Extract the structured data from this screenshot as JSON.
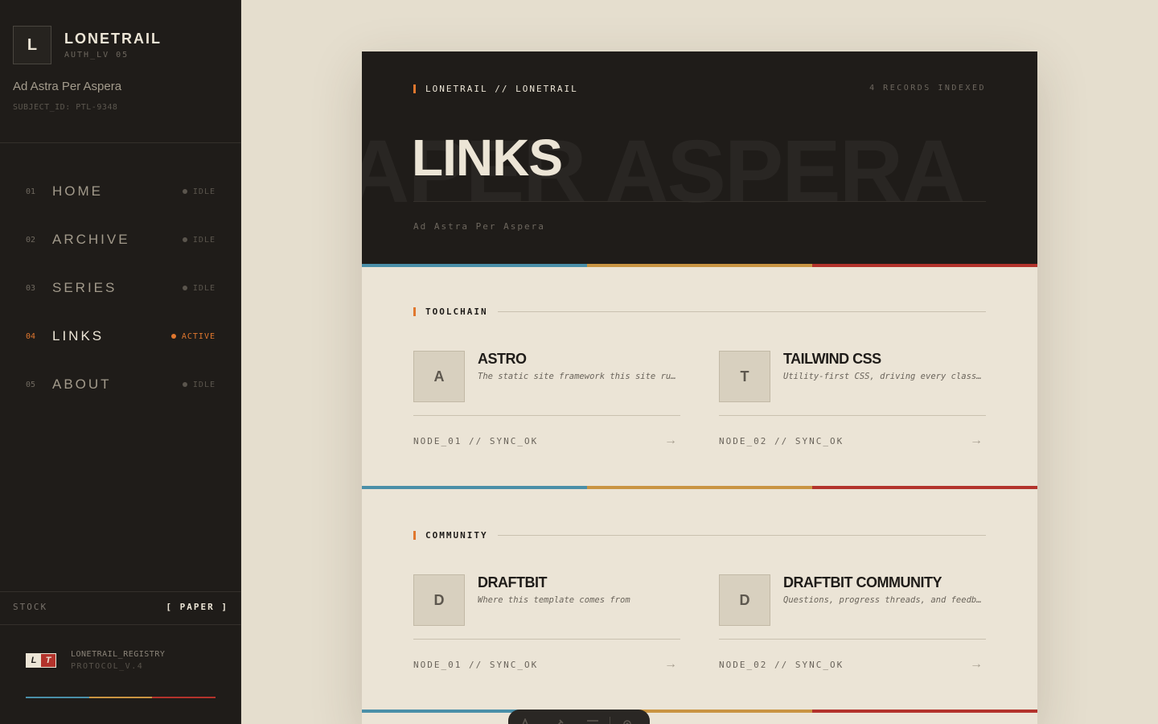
{
  "sidebar": {
    "brand_initial": "L",
    "brand_name": "LONETRAIL",
    "brand_sub": "AUTH_LV 05",
    "tagline": "Ad Astra Per Aspera",
    "subject_id": "SUBJECT_ID: PTL-9348",
    "nav": [
      {
        "num": "01",
        "label": "HOME",
        "status": "IDLE"
      },
      {
        "num": "02",
        "label": "ARCHIVE",
        "status": "IDLE"
      },
      {
        "num": "03",
        "label": "SERIES",
        "status": "IDLE"
      },
      {
        "num": "04",
        "label": "LINKS",
        "status": "ACTIVE"
      },
      {
        "num": "05",
        "label": "ABOUT",
        "status": "IDLE"
      }
    ],
    "stock_label": "STOCK",
    "stock_value": "[ PAPER ]",
    "registry_logo_l": "L",
    "registry_logo_t": "T",
    "registry_name": "LONETRAIL_REGISTRY",
    "registry_protocol": "PROTOCOL_V.4"
  },
  "hero": {
    "crumb": "LONETRAIL // LONETRAIL",
    "count": "4 RECORDS INDEXED",
    "bg_text": "APER ASPERA",
    "title": "LINKS",
    "subtitle": "Ad Astra Per Aspera"
  },
  "sections": [
    {
      "title": "TOOLCHAIN",
      "links": [
        {
          "initial": "A",
          "title": "ASTRO",
          "desc": "The static site framework this site runs on",
          "node": "NODE_01 // SYNC_OK",
          "arrow": "→"
        },
        {
          "initial": "T",
          "title": "TAILWIND CSS",
          "desc": "Utility-first CSS, driving every class on the page",
          "node": "NODE_02 // SYNC_OK",
          "arrow": "→"
        }
      ]
    },
    {
      "title": "COMMUNITY",
      "links": [
        {
          "initial": "D",
          "title": "DRAFTBIT",
          "desc": "Where this template comes from",
          "node": "NODE_01 // SYNC_OK",
          "arrow": "→"
        },
        {
          "initial": "D",
          "title": "DRAFTBIT COMMUNITY",
          "desc": "Questions, progress threads, and feedback",
          "node": "NODE_02 // SYNC_OK",
          "arrow": "→"
        }
      ]
    }
  ],
  "colors": {
    "accent": "#e0772e",
    "stripe_blue": "#4a8fa8",
    "stripe_gold": "#c99442",
    "stripe_red": "#b3332c",
    "dark": "#1f1c19",
    "paper": "#ebe4d6"
  },
  "dock": {
    "icons": [
      "text-icon",
      "brush-icon",
      "menu-icon",
      "gear-icon"
    ]
  }
}
